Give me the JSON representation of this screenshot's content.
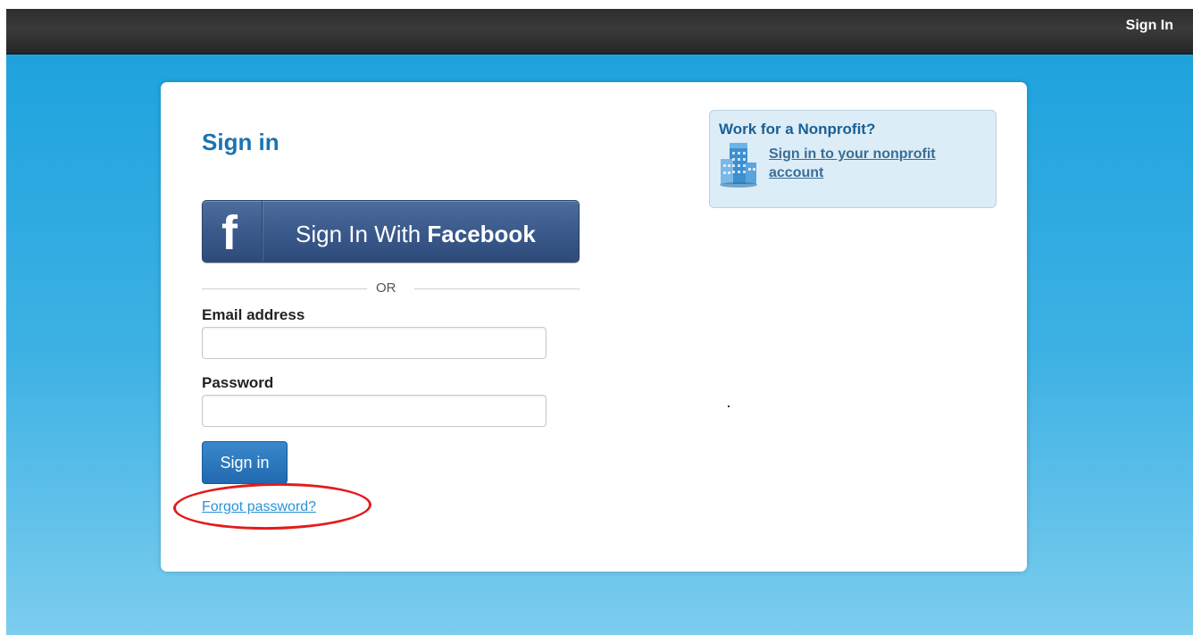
{
  "topbar": {
    "signin_link": "Sign In"
  },
  "card": {
    "title": "Sign in",
    "facebook_button": {
      "logo_letter": "f",
      "label_prefix": "Sign In With ",
      "label_brand": "Facebook"
    },
    "divider_text": "OR",
    "email": {
      "label": "Email address",
      "value": "",
      "placeholder": ""
    },
    "password": {
      "label": "Password",
      "value": "",
      "placeholder": ""
    },
    "signin_button": "Sign in",
    "forgot_link": "Forgot password?"
  },
  "nonprofit": {
    "title": "Work for a Nonprofit?",
    "link": "Sign in to your nonprofit account",
    "icon": "building-icon"
  },
  "colors": {
    "accent": "#1b73b0",
    "facebook": "#3b5a8c",
    "highlight": "#e31b1b",
    "link": "#2a92d6"
  }
}
